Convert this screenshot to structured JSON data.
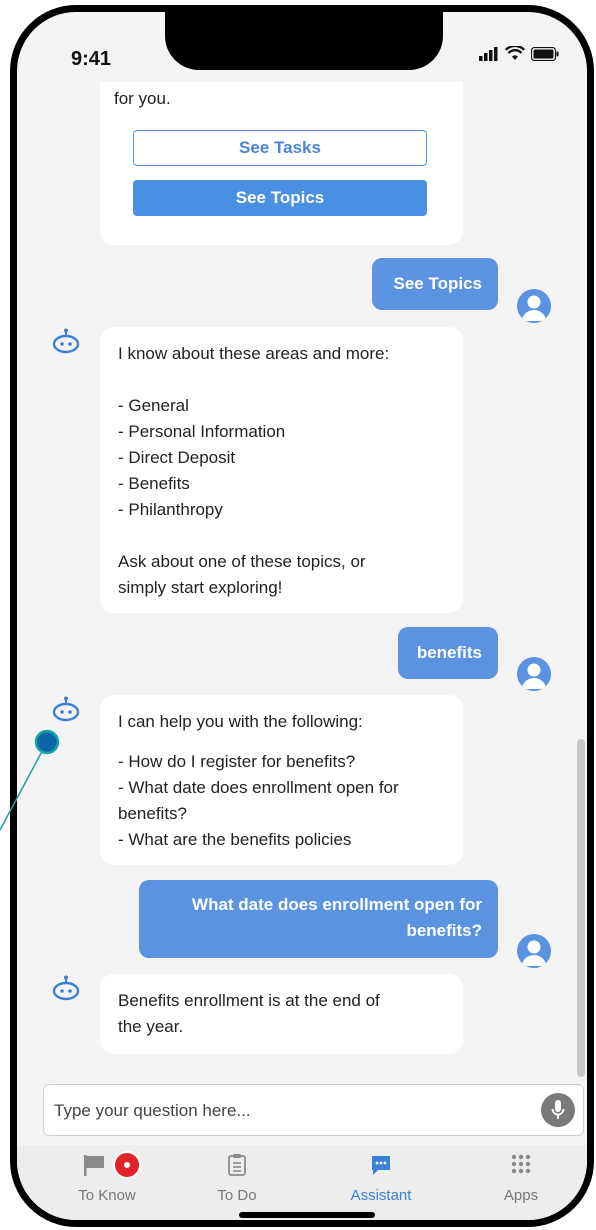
{
  "status": {
    "time": "9:41"
  },
  "messages": {
    "intro_tail": "for you.",
    "see_tasks": "See Tasks",
    "see_topics": "See Topics",
    "user1": "See Topics",
    "bot2": [
      "I know about these areas and more:",
      "",
      "- General",
      "- Personal Information",
      "- Direct Deposit",
      "- Benefits",
      "- Philanthropy",
      "",
      "Ask about one of these topics, or",
      "simply start exploring!"
    ],
    "user2": "benefits",
    "bot3": [
      "I can help you with the following:",
      "",
      "- How do I register for benefits?",
      "- What date does enrollment open for",
      "benefits?",
      "- What are the benefits policies"
    ],
    "user3": [
      "What date does enrollment open for",
      "benefits?"
    ],
    "bot4": [
      "Benefits enrollment is at the end of",
      "the year."
    ]
  },
  "input": {
    "placeholder": "Type your question here..."
  },
  "tabs": [
    {
      "label": "To Know"
    },
    {
      "label": "To Do"
    },
    {
      "label": "Assistant"
    },
    {
      "label": "Apps"
    }
  ],
  "colors": {
    "accent": "#5b93e0",
    "active_tab": "#3b82d6",
    "badge": "#e0242a"
  }
}
